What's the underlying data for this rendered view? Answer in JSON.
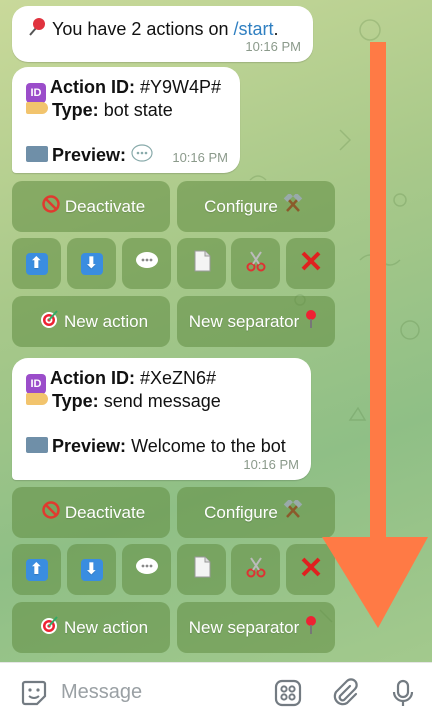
{
  "messages": [
    {
      "prefix": "You have 2 actions on ",
      "link": "/start",
      "suffix": ".",
      "time": "10:16 PM"
    },
    {
      "id_label": "Action ID:",
      "id_value": "#Y9W4P#",
      "type_label": "Type:",
      "type_value": "bot state",
      "preview_label": "Preview:",
      "preview_value": "",
      "time": "10:16 PM"
    },
    {
      "id_label": "Action ID:",
      "id_value": "#XeZN6#",
      "type_label": "Type:",
      "type_value": "send message",
      "preview_label": "Preview:",
      "preview_value": "Welcome to the bot",
      "time": "10:16 PM"
    }
  ],
  "keyboard": {
    "deactivate": "Deactivate",
    "configure": "Configure",
    "new_action": "New action",
    "new_separator": "New separator"
  },
  "composer": {
    "placeholder": "Message"
  },
  "icons": [
    "pushpin-icon",
    "id-icon",
    "tag-icon",
    "folder-icon",
    "speech-bubble-icon",
    "no-entry-icon",
    "hammer-pick-icon",
    "up-arrow-icon",
    "down-arrow-icon",
    "page-icon",
    "scissors-icon",
    "cross-icon",
    "target-icon",
    "pin-icon",
    "sticker-icon",
    "apps-icon",
    "paperclip-icon",
    "microphone-icon",
    "scroll-down-arrow"
  ],
  "colors": {
    "arrow": "#ff7a45",
    "link": "#2f7fc1",
    "keyboard_button": "#6e9b52"
  }
}
